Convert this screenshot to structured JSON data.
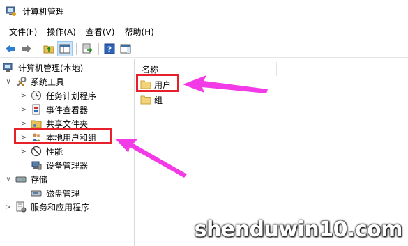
{
  "window": {
    "title": "计算机管理"
  },
  "menu": [
    "文件(F)",
    "操作(A)",
    "查看(V)",
    "帮助(H)"
  ],
  "toolbar": {
    "icons": [
      "back-arrow-icon",
      "forward-arrow-icon",
      "up-folder-icon",
      "show-hide-tree-icon",
      "export-list-icon",
      "help-icon",
      "action-pane-icon"
    ]
  },
  "tree": {
    "root": "计算机管理(本地)",
    "system_tools": "系统工具",
    "task_scheduler": "任务计划程序",
    "event_viewer": "事件查看器",
    "shared_folders": "共享文件夹",
    "local_users": "本地用户和组",
    "performance": "性能",
    "device_manager": "设备管理器",
    "storage": "存储",
    "disk_management": "磁盘管理",
    "services": "服务和应用程序"
  },
  "list": {
    "column_name": "名称",
    "items": [
      "用户",
      "组"
    ]
  },
  "annotation_colors": {
    "box": "#e8202a",
    "arrow": "#f23be6"
  },
  "watermark": "shenduwin10.com"
}
